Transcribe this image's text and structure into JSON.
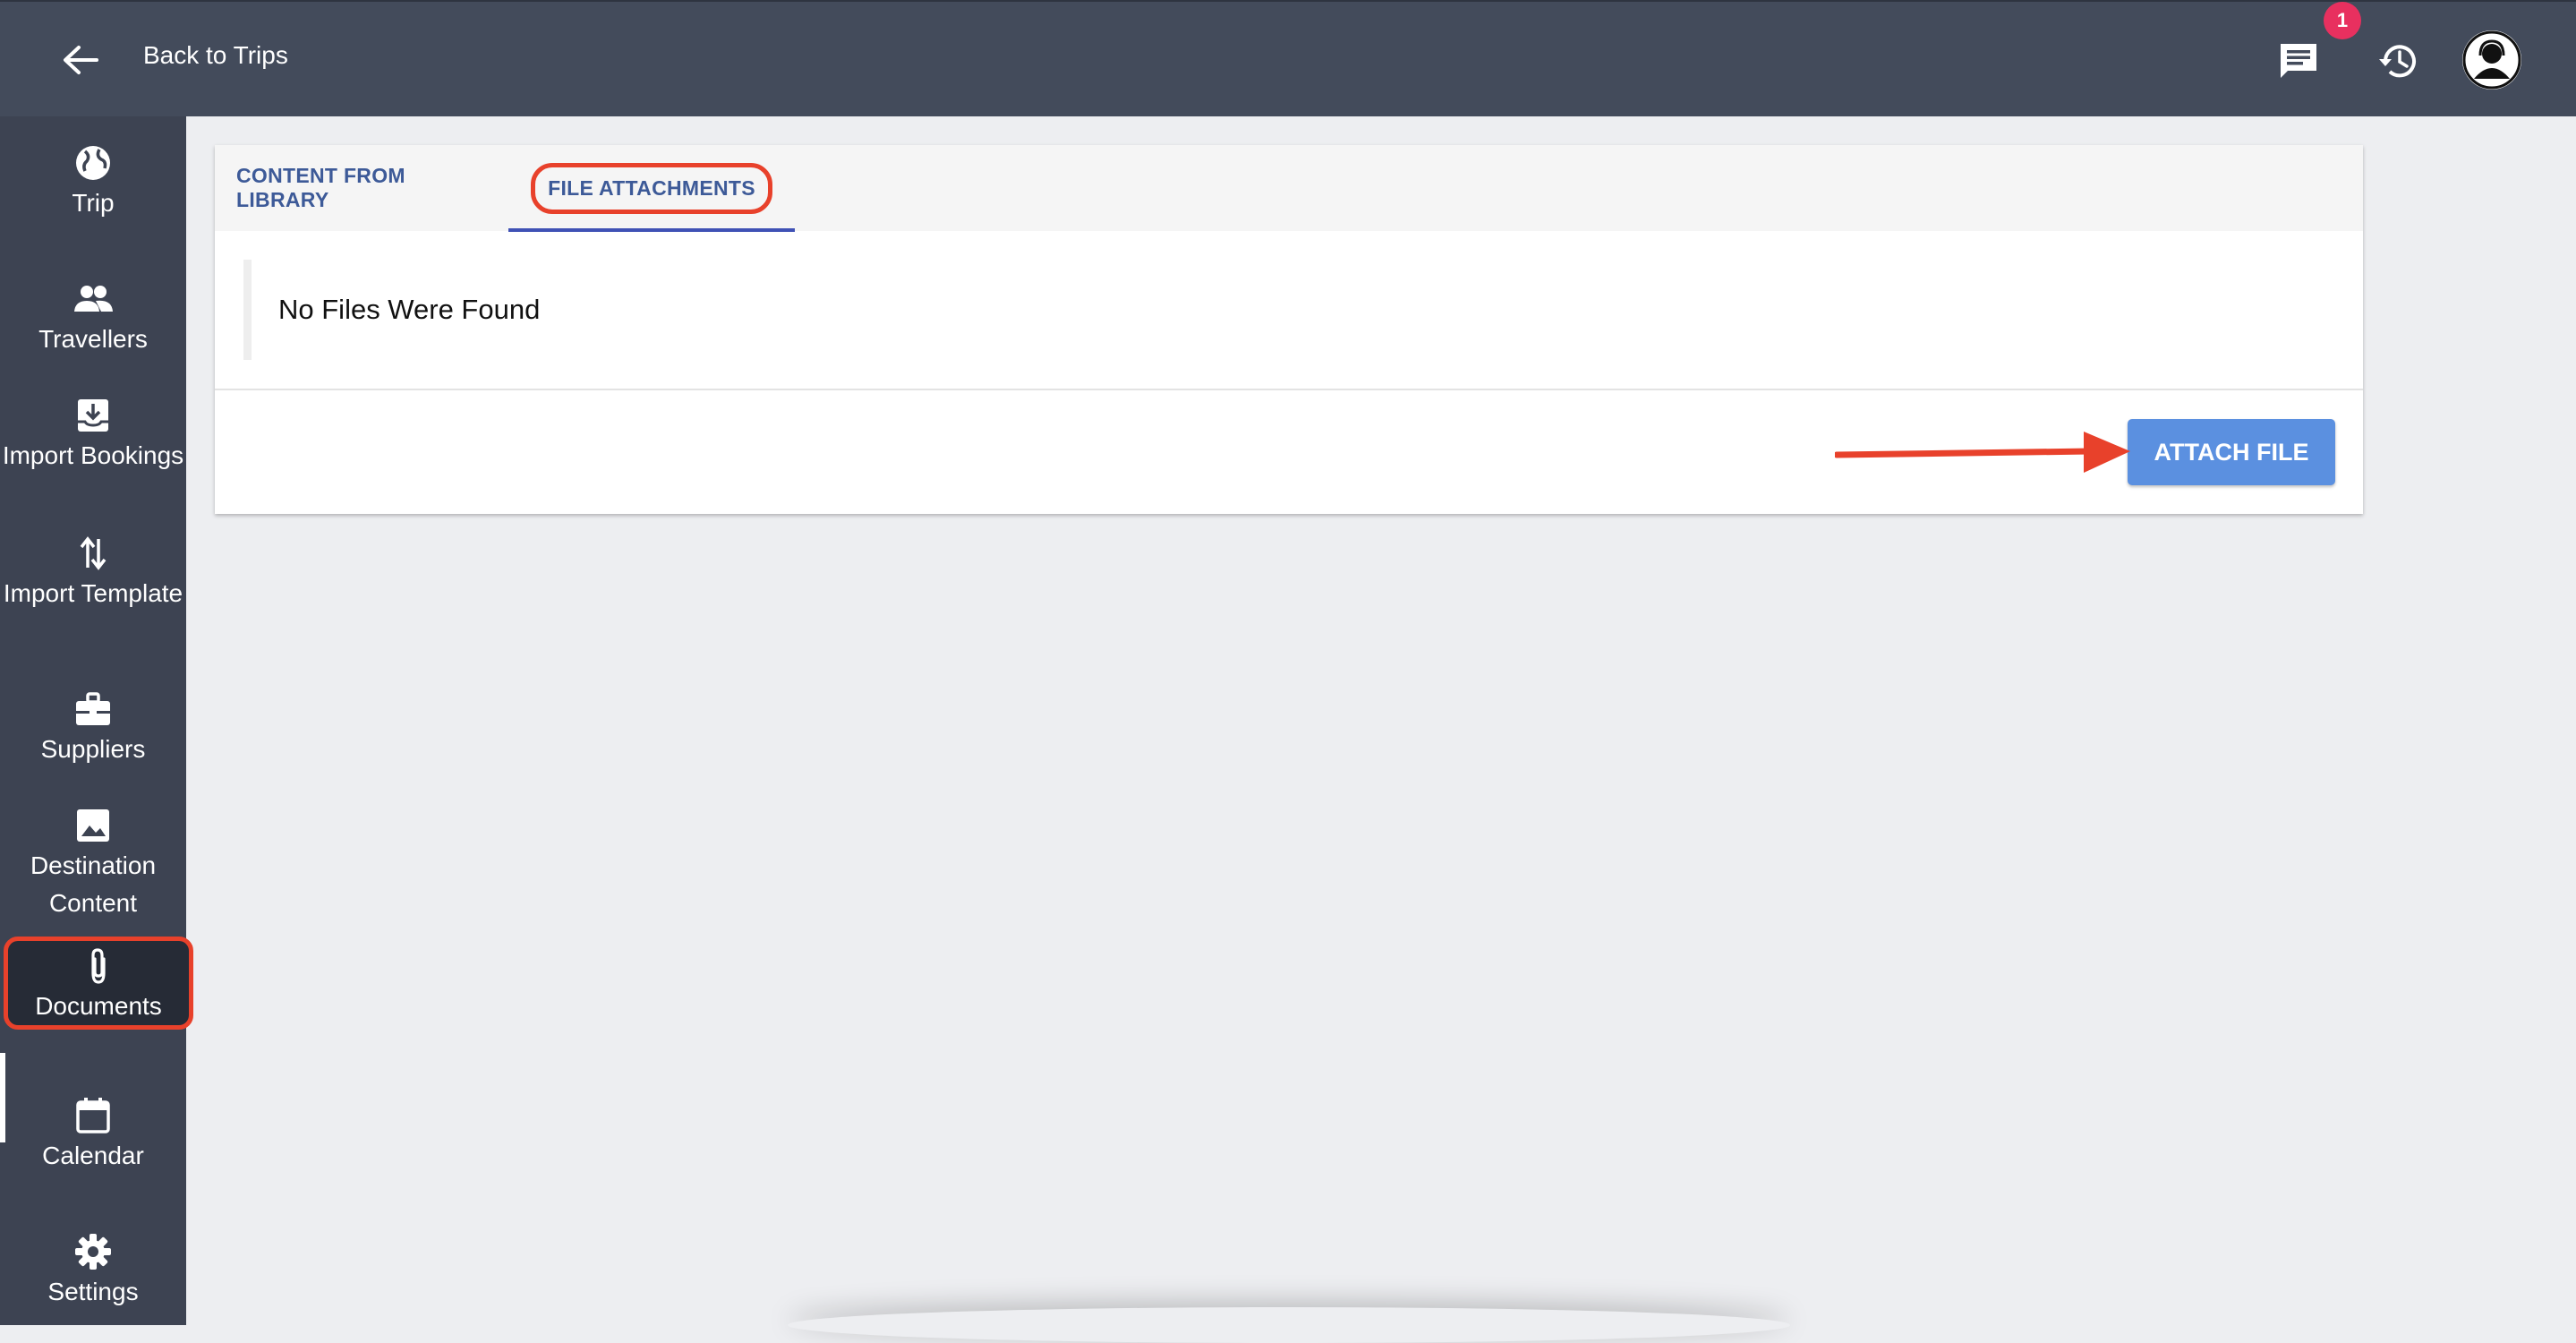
{
  "header": {
    "back_label": "Back to Trips",
    "notification_count": "1",
    "icons": [
      "back-arrow-icon",
      "chat-icon",
      "history-icon",
      "user-avatar-icon"
    ]
  },
  "sidebar": {
    "items": [
      {
        "label": "Trip",
        "icon": "globe-icon"
      },
      {
        "label": "Travellers",
        "icon": "people-icon"
      },
      {
        "label": "Import Bookings",
        "icon": "import-box-icon"
      },
      {
        "label": "Import Template",
        "icon": "swap-vertical-icon"
      },
      {
        "label": "Suppliers",
        "icon": "briefcase-icon"
      },
      {
        "label": "Destination Content",
        "icon": "image-icon"
      },
      {
        "label": "Documents",
        "icon": "paperclip-icon",
        "active": true
      },
      {
        "label": "Calendar",
        "icon": "calendar-icon"
      },
      {
        "label": "Settings",
        "icon": "gear-icon"
      }
    ]
  },
  "main": {
    "tabs": [
      {
        "label": "CONTENT FROM LIBRARY"
      },
      {
        "label": "FILE ATTACHMENTS",
        "selected": true
      }
    ],
    "empty_message": "No Files Were Found",
    "attach_button": "ATTACH FILE"
  },
  "colors": {
    "topbar": "#434b5b",
    "sidebar": "#3d4352",
    "accent_blue": "#5b90e0",
    "tab_text": "#3d5a98",
    "annotation_red": "#e8412b",
    "badge": "#e8305f"
  }
}
